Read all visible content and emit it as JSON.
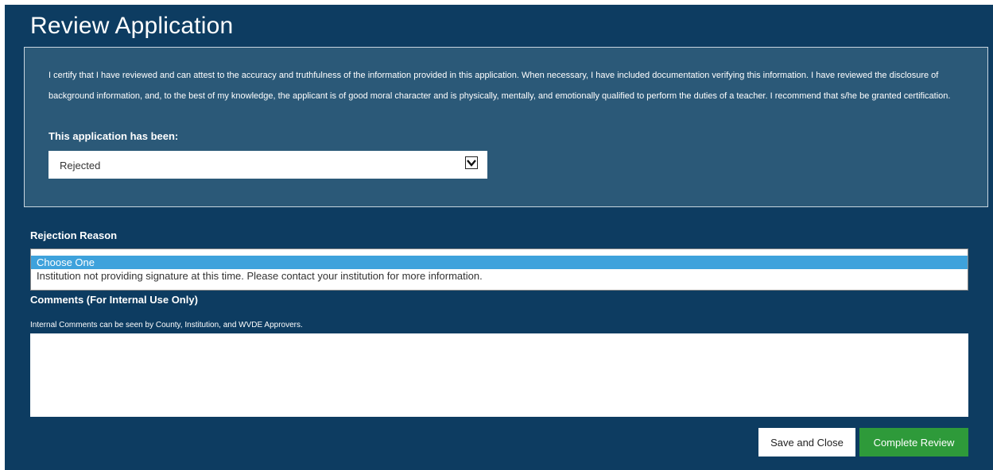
{
  "page": {
    "title": "Review Application"
  },
  "certification": {
    "text": "I certify that I have reviewed and can attest to the accuracy and truthfulness of the information provided in this application. When necessary, I have included documentation verifying this information. I have reviewed the disclosure of background information, and, to the best of my knowledge, the applicant is of good moral character and is physically, mentally, and emotionally qualified to perform the duties of a teacher. I recommend that s/he be granted certification.",
    "status_label": "This application has been:",
    "status_value": "Rejected"
  },
  "rejection": {
    "label": "Rejection Reason",
    "options": [
      "Choose One",
      "Institution not providing signature at this time. Please contact your institution for more information."
    ],
    "selected_index": 0
  },
  "comments": {
    "label": "Comments (For Internal Use Only)",
    "note": "Internal Comments can be seen by County, Institution, and WVDE Approvers.",
    "value": ""
  },
  "actions": {
    "save_label": "Save and Close",
    "complete_label": "Complete Review"
  },
  "colors": {
    "panel_bg": "#0d3c61",
    "cert_bg": "#2b5978",
    "selected_option": "#3ea2dc",
    "complete_button": "#2e9a3a"
  },
  "icons": {
    "status_dropdown": "chevron-down-icon"
  }
}
